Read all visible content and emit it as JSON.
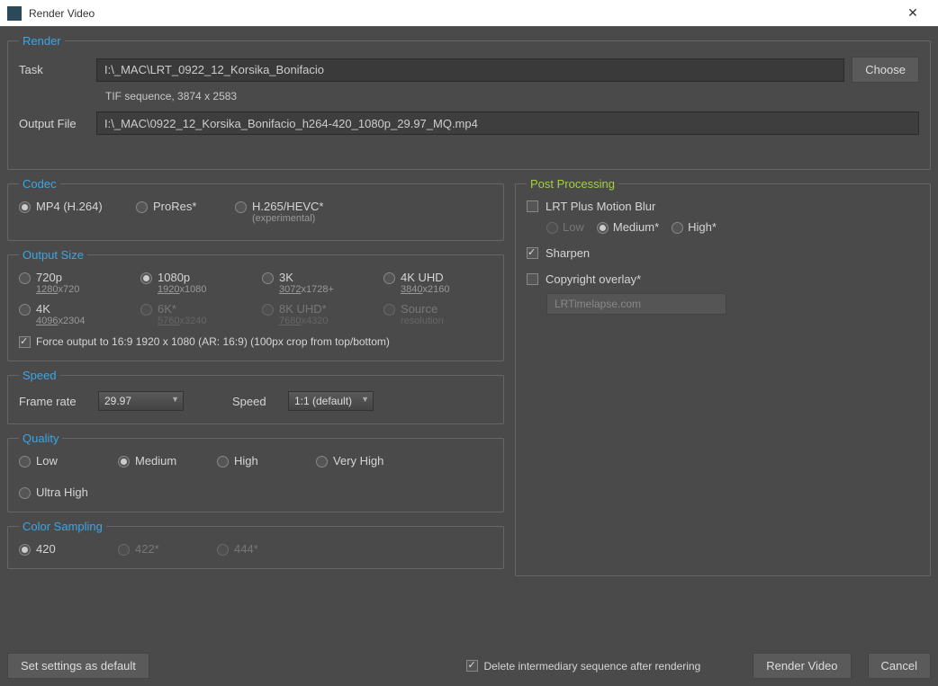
{
  "title": "Render Video",
  "render": {
    "legend": "Render",
    "task_label": "Task",
    "task_value": "I:\\_MAC\\LRT_0922_12_Korsika_Bonifacio",
    "choose_label": "Choose",
    "subtext": "TIF sequence, 3874 x 2583",
    "output_label": "Output File",
    "output_value": "I:\\_MAC\\0922_12_Korsika_Bonifacio_h264-420_1080p_29.97_MQ.mp4"
  },
  "codec": {
    "legend": "Codec",
    "options": [
      {
        "label": "MP4 (H.264)",
        "sub": "",
        "checked": true
      },
      {
        "label": "ProRes*",
        "sub": "",
        "checked": false
      },
      {
        "label": "H.265/HEVC*",
        "sub": "(experimental)",
        "checked": false
      }
    ]
  },
  "output_size": {
    "legend": "Output Size",
    "row1": [
      {
        "label": "720p",
        "sub_u": "1280",
        "sub_r": "x720",
        "checked": false,
        "disabled": false
      },
      {
        "label": "1080p",
        "sub_u": "1920",
        "sub_r": "x1080",
        "checked": true,
        "disabled": false
      },
      {
        "label": "3K",
        "sub_u": "3072",
        "sub_r": "x1728+",
        "checked": false,
        "disabled": false
      },
      {
        "label": "4K UHD",
        "sub_u": "3840",
        "sub_r": "x2160",
        "checked": false,
        "disabled": false
      }
    ],
    "row2": [
      {
        "label": "4K",
        "sub_u": "4096",
        "sub_r": "x2304",
        "checked": false,
        "disabled": false
      },
      {
        "label": "6K*",
        "sub_u": "5760",
        "sub_r": "x3240",
        "checked": false,
        "disabled": true
      },
      {
        "label": "8K UHD*",
        "sub_u": "7680",
        "sub_r": "x4320",
        "checked": false,
        "disabled": true
      },
      {
        "label": "Source",
        "sub_u": "",
        "sub_r": "resolution",
        "checked": false,
        "disabled": true
      }
    ],
    "force_label": "Force output to 16:9  1920 x 1080 (AR: 16:9) (100px crop from top/bottom)"
  },
  "speed": {
    "legend": "Speed",
    "frame_rate_label": "Frame rate",
    "frame_rate_value": "29.97",
    "speed_label": "Speed",
    "speed_value": "1:1 (default)"
  },
  "quality": {
    "legend": "Quality",
    "options": [
      {
        "label": "Low",
        "checked": false
      },
      {
        "label": "Medium",
        "checked": true
      },
      {
        "label": "High",
        "checked": false
      },
      {
        "label": "Very High",
        "checked": false
      },
      {
        "label": "Ultra High",
        "checked": false
      }
    ]
  },
  "color_sampling": {
    "legend": "Color Sampling",
    "options": [
      {
        "label": "420",
        "checked": true,
        "disabled": false
      },
      {
        "label": "422*",
        "checked": false,
        "disabled": true
      },
      {
        "label": "444*",
        "checked": false,
        "disabled": true
      }
    ]
  },
  "post_processing": {
    "legend": "Post Processing",
    "motion_blur_label": "LRT Plus Motion Blur",
    "motion_blur_checked": false,
    "mb_options": [
      {
        "label": "Low",
        "checked": false,
        "disabled": true
      },
      {
        "label": "Medium*",
        "checked": true,
        "disabled": false
      },
      {
        "label": "High*",
        "checked": false,
        "disabled": false
      }
    ],
    "sharpen_label": "Sharpen",
    "sharpen_checked": true,
    "copyright_label": "Copyright overlay*",
    "copyright_checked": false,
    "copyright_value": "LRTimelapse.com"
  },
  "footer": {
    "set_default": "Set settings as default",
    "delete_intermediary": "Delete intermediary sequence after rendering",
    "render": "Render Video",
    "cancel": "Cancel"
  }
}
